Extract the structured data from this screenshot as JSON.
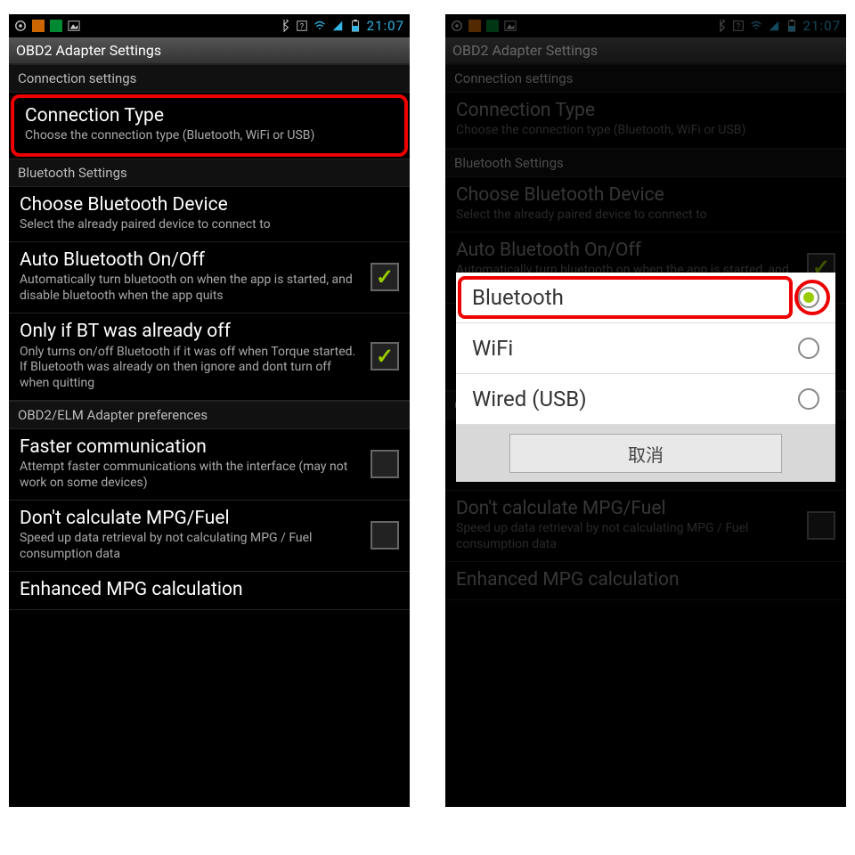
{
  "statusbar": {
    "time": "21:07"
  },
  "app_title": "OBD2 Adapter Settings",
  "sections": {
    "conn": "Connection settings",
    "bt": "Bluetooth Settings",
    "obd": "OBD2/ELM Adapter preferences"
  },
  "items": {
    "conn_type": {
      "title": "Connection Type",
      "sub": "Choose the connection type (Bluetooth, WiFi or USB)"
    },
    "choose_bt": {
      "title": "Choose Bluetooth Device",
      "sub": "Select the already paired device to connect to"
    },
    "auto_bt": {
      "title": "Auto Bluetooth On/Off",
      "sub": "Automatically turn bluetooth on when the app is started, and disable bluetooth when the app quits"
    },
    "only_off": {
      "title": "Only if BT was already off",
      "sub": "Only turns on/off Bluetooth if it was off when Torque started. If Bluetooth was already on then ignore and dont turn off when quitting"
    },
    "faster": {
      "title": "Faster communication",
      "sub": "Attempt faster communications with the interface (may not work on some devices)"
    },
    "no_mpg": {
      "title": "Don't calculate MPG/Fuel",
      "sub": "Speed up data retrieval by not calculating MPG / Fuel consumption data"
    },
    "enh_mpg": {
      "title": "Enhanced MPG calculation"
    }
  },
  "dialog": {
    "opt1": "Bluetooth",
    "opt2": "WiFi",
    "opt3": "Wired (USB)",
    "cancel": "取消"
  }
}
